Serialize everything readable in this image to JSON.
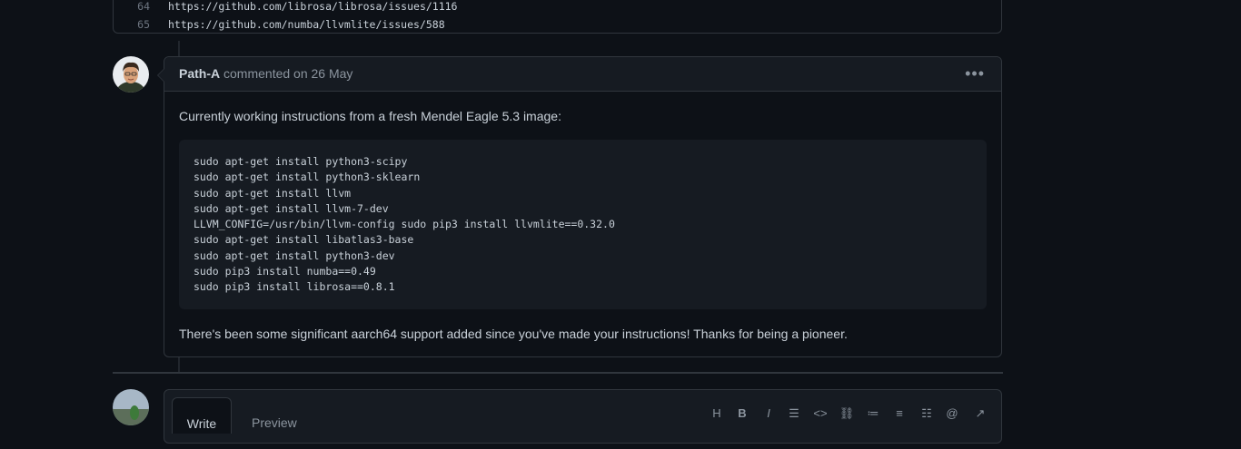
{
  "previous_code": {
    "lines": [
      {
        "num": "64",
        "text": "https://github.com/librosa/librosa/issues/1116"
      },
      {
        "num": "65",
        "text": "https://github.com/numba/llvmlite/issues/588"
      }
    ]
  },
  "comment": {
    "author": "Path-A",
    "meta": "commented on 26 May",
    "menu_icon": "kebab-horizontal-icon",
    "intro": "Currently working instructions from a fresh Mendel Eagle 5.3 image:",
    "code": [
      "sudo apt-get install python3-scipy",
      "sudo apt-get install python3-sklearn",
      "sudo apt-get install llvm",
      "sudo apt-get install llvm-7-dev",
      "LLVM_CONFIG=/usr/bin/llvm-config sudo pip3 install llvmlite==0.32.0",
      "sudo apt-get install libatlas3-base",
      "sudo apt-get install python3-dev",
      "sudo pip3 install numba==0.49",
      "sudo pip3 install librosa==0.8.1"
    ],
    "outro": "There's been some significant aarch64 support added since you've made your instructions! Thanks for being a pioneer."
  },
  "editor": {
    "tab_write": "Write",
    "tab_preview": "Preview",
    "toolbar_icons": [
      "heading-icon",
      "bold-icon",
      "italic-icon",
      "quote-icon",
      "code-icon",
      "link-icon",
      "unordered-list-icon",
      "ordered-list-icon",
      "task-list-icon",
      "mention-icon",
      "cross-reference-icon"
    ]
  },
  "colors": {
    "background": "#0d1117",
    "border": "#30363d",
    "header_bg": "#161b22",
    "muted_text": "#8b949e",
    "text": "#c9d1d9"
  }
}
